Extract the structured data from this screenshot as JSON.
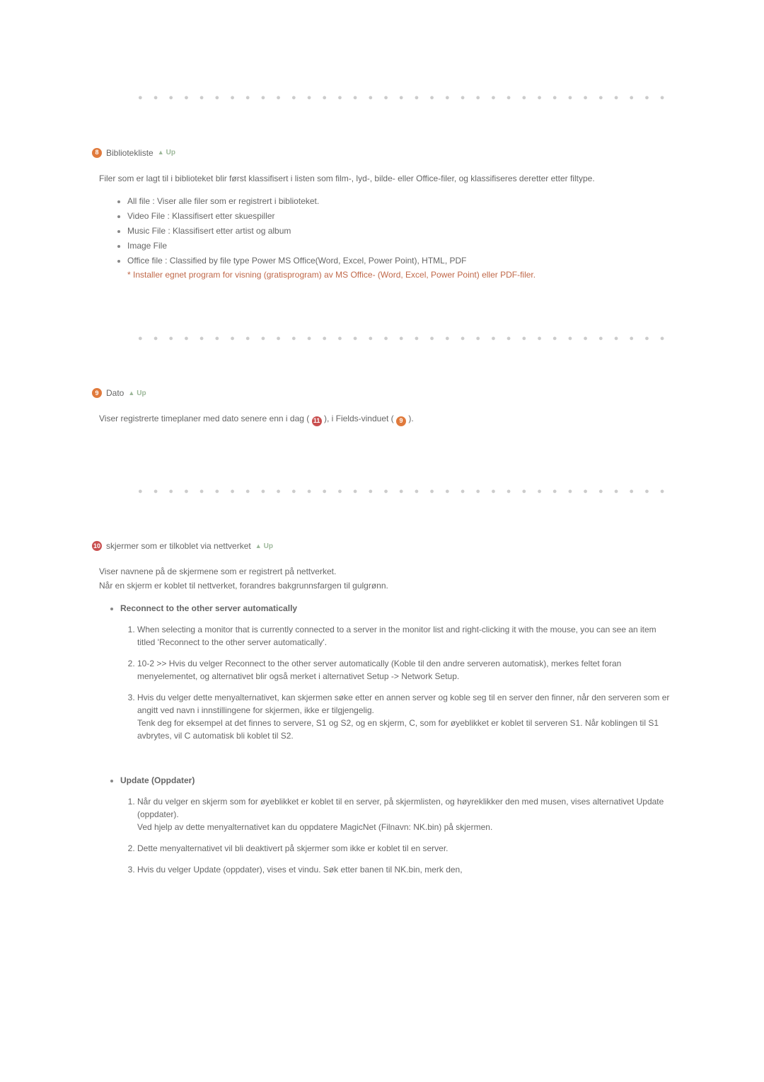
{
  "up_label": "Up",
  "sec8": {
    "num": "8",
    "title": "Bibliotekliste",
    "intro": "Filer som er lagt til i biblioteket blir først klassifisert i listen som film-, lyd-, bilde- eller Office-filer, og klassifiseres deretter etter filtype.",
    "b1": "All file : Viser alle filer som er registrert i biblioteket.",
    "b2": "Video File : Klassifisert etter skuespiller",
    "b3": "Music File : Klassifisert etter artist og album",
    "b4": "Image File",
    "b5": "Office file : Classified by file type Power MS Office(Word, Excel, Power Point), HTML, PDF",
    "b5_note": "* Installer egnet program for visning (gratisprogram) av MS Office- (Word, Excel, Power Point) eller PDF-filer."
  },
  "sec9": {
    "num": "9",
    "title": "Dato",
    "text_a": "Viser registrerte timeplaner med dato senere enn i dag (",
    "badge1": "11",
    "text_b": "), i Fields-vinduet (",
    "badge2": "9",
    "text_c": ")."
  },
  "sec10": {
    "num": "10",
    "title": "skjermer som er tilkoblet via nettverket",
    "p1": "Viser navnene på de skjermene som er registrert på nettverket.",
    "p2": "Når en skjerm er koblet til nettverket, forandres bakgrunnsfargen til gulgrønn.",
    "reconnect": {
      "heading": "Reconnect to the other server automatically",
      "n1": "When selecting a monitor that is currently connected to a server in the monitor list and right-clicking it with the mouse, you can see an item titled 'Reconnect to the other server automatically'.",
      "n2": "10-2 >> Hvis du velger Reconnect to the other server automatically (Koble til den andre serveren automatisk), merkes feltet foran menyelementet, og alternativet blir også merket i alternativet Setup -> Network Setup.",
      "n3a": "Hvis du velger dette menyalternativet, kan skjermen søke etter en annen server og koble seg til en server den finner, når den serveren som er angitt ved navn i innstillingene for skjermen, ikke er tilgjengelig.",
      "n3b": "Tenk deg for eksempel at det finnes to servere, S1 og S2, og en skjerm, C, som for øyeblikket er koblet til serveren S1. Når koblingen til S1 avbrytes, vil C automatisk bli koblet til S2."
    },
    "update": {
      "heading": "Update (Oppdater)",
      "n1a": "Når du velger en skjerm som for øyeblikket er koblet til en server, på skjermlisten, og høyreklikker den med musen, vises alternativet Update (oppdater).",
      "n1b": "Ved hjelp av dette menyalternativet kan du oppdatere MagicNet (Filnavn: NK.bin) på skjermen.",
      "n2": "Dette menyalternativet vil bli deaktivert på skjermer som ikke er koblet til en server.",
      "n3": "Hvis du velger Update (oppdater), vises et vindu. Søk etter banen til NK.bin, merk den,"
    }
  }
}
